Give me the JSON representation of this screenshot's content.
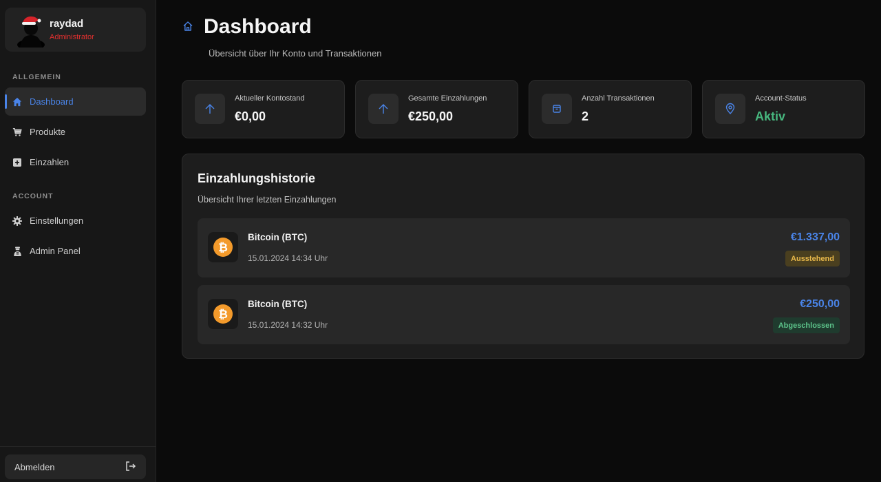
{
  "user": {
    "name": "raydad",
    "role": "Administrator"
  },
  "sidebar": {
    "section_general": "ALLGEMEIN",
    "section_account": "ACCOUNT",
    "items": [
      {
        "label": "Dashboard",
        "icon": "home-icon",
        "active": true
      },
      {
        "label": "Produkte",
        "icon": "cart-icon"
      },
      {
        "label": "Einzahlen",
        "icon": "plus-square-icon"
      },
      {
        "label": "Einstellungen",
        "icon": "gear-icon"
      },
      {
        "label": "Admin Panel",
        "icon": "admin-icon"
      }
    ],
    "logout_label": "Abmelden"
  },
  "page": {
    "title": "Dashboard",
    "subtitle": "Übersicht über Ihr Konto und Transaktionen"
  },
  "stats": [
    {
      "label": "Aktueller Kontostand",
      "value": "€0,00",
      "icon": "arrow-up-icon"
    },
    {
      "label": "Gesamte Einzahlungen",
      "value": "€250,00",
      "icon": "arrow-up-icon"
    },
    {
      "label": "Anzahl Transaktionen",
      "value": "2",
      "icon": "box-icon"
    },
    {
      "label": "Account-Status",
      "value": "Aktiv",
      "icon": "location-icon"
    }
  ],
  "history": {
    "title": "Einzahlungshistorie",
    "subtitle": "Übersicht Ihrer letzten Einzahlungen",
    "transactions": [
      {
        "name": "Bitcoin (BTC)",
        "date": "15.01.2024 14:34 Uhr",
        "amount": "€1.337,00",
        "status": "Ausstehend"
      },
      {
        "name": "Bitcoin (BTC)",
        "date": "15.01.2024 14:32 Uhr",
        "amount": "€250,00",
        "status": "Abgeschlossen"
      }
    ]
  },
  "colors": {
    "accent": "#4a84e8",
    "role": "#e0302f",
    "active_status": "#47b87f",
    "bitcoin": "#f39a2b"
  }
}
